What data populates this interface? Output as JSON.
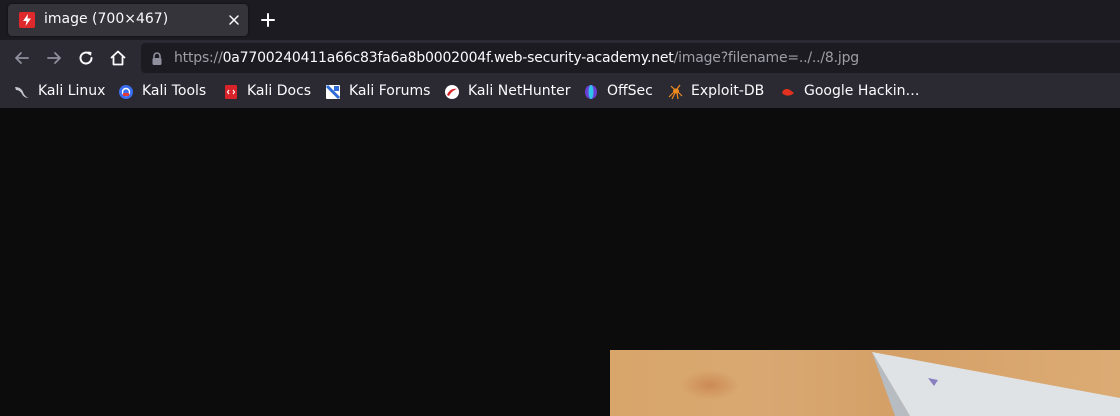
{
  "tab": {
    "title": "image (700×467)",
    "favicon": "lightning-bolt-icon"
  },
  "nav": {
    "url_scheme": "https://",
    "url_host": "0a7700240411a66c83fa6a8b0002004f.web-security-academy.net",
    "url_path": "/image?filename=../../8.jpg"
  },
  "bookmarks": [
    {
      "label": "Kali Linux",
      "icon": "kali-dragon-icon"
    },
    {
      "label": "Kali Tools",
      "icon": "kali-tools-icon"
    },
    {
      "label": "Kali Docs",
      "icon": "kali-docs-icon"
    },
    {
      "label": "Kali Forums",
      "icon": "kali-forums-icon"
    },
    {
      "label": "Kali NetHunter",
      "icon": "nethunter-icon"
    },
    {
      "label": "OffSec",
      "icon": "offsec-icon"
    },
    {
      "label": "Exploit-DB",
      "icon": "exploit-db-spider-icon"
    },
    {
      "label": "Google Hackin…",
      "icon": "google-hacking-icon"
    }
  ],
  "colors": {
    "tabstrip": "#1c1b22",
    "toolbar": "#2b2a33",
    "content_background": "#0c0c0d",
    "favicon_red": "#e0292c"
  }
}
